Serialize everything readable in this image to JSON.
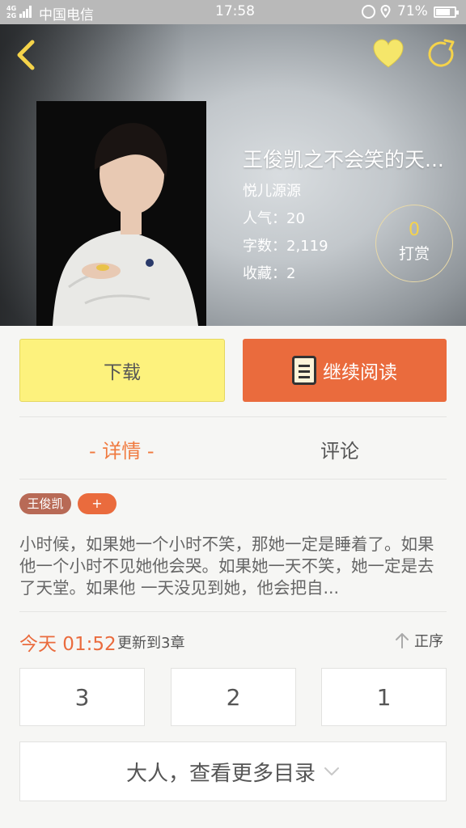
{
  "status_bar": {
    "network_top": "4G",
    "network_bottom": "2G",
    "carrier": "中国电信",
    "time": "17:58",
    "battery_percent": "71%",
    "battery_level": 0.71
  },
  "header": {
    "back_icon": "chevron-left-icon",
    "favorite_icon": "heart-icon",
    "share_icon": "refresh-share-icon",
    "accent_color": "#f5d34a"
  },
  "book": {
    "title": "王俊凯之不会笑的天...",
    "author": "悦儿源源",
    "popularity": "人气：20",
    "word_count": "字数：2,119",
    "favorites": "收藏：2",
    "tip_count": "0",
    "tip_label": "打赏",
    "cover_icon": "portrait-cover-image"
  },
  "actions": {
    "download_label": "下载",
    "read_label": "继续阅读",
    "download_color": "#fdf27d",
    "read_color": "#ea6b3d"
  },
  "tabs": [
    {
      "label": "- 详情 -",
      "active": true
    },
    {
      "label": "评论",
      "active": false
    }
  ],
  "tags": [
    {
      "label": "王俊凯"
    },
    {
      "label": "+"
    }
  ],
  "description": "小时候，如果她一个小时不笑，那她一定是睡着了。如果他一个小时不见她他会哭。如果她一天不笑，她一定是去了天堂。如果他 一天没见到她，他会把自...",
  "update": {
    "time": "今天 01:52",
    "text": "更新到3章",
    "sort_label": "正序"
  },
  "chapters": [
    "3",
    "2",
    "1"
  ],
  "more_label": "大人，查看更多目录"
}
